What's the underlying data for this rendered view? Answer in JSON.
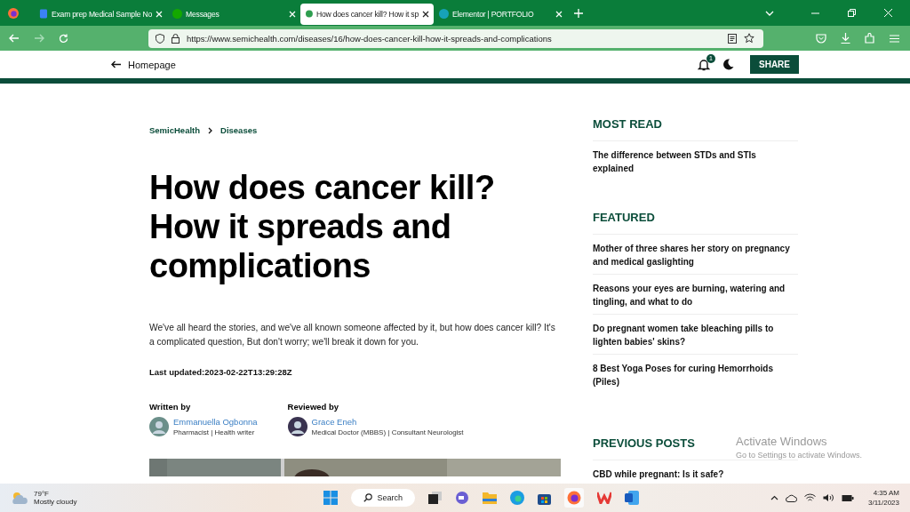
{
  "browser": {
    "tabs": [
      {
        "title": "Exam prep Medical Sample No",
        "selected": false
      },
      {
        "title": "Messages",
        "selected": false
      },
      {
        "title": "How does cancer kill? How it sp",
        "selected": true
      },
      {
        "title": "Elementor | PORTFOLIO",
        "selected": false
      }
    ],
    "url": "https://www.semichealth.com/diseases/16/how-does-cancer-kill-how-it-spreads-and-complications"
  },
  "header": {
    "back_label": "Homepage",
    "notification_count": "1",
    "share_label": "SHARE"
  },
  "breadcrumb": [
    "SemicHealth",
    "Diseases"
  ],
  "article": {
    "title": "How does cancer kill? How it spreads and complications",
    "intro": "We've all heard the stories, and we've all known someone affected by it, but how does cancer kill? It's a complicated question, But don't worry; we'll break it down for you.",
    "last_updated": "Last updated:2023-02-22T13:29:28Z",
    "authors": [
      {
        "role": "Written by",
        "name": "Emmanuella Ogbonna",
        "credentials": "Pharmacist | Health writer"
      },
      {
        "role": "Reviewed by",
        "name": "Grace Eneh",
        "credentials": "Medical Doctor (MBBS) | Consultant Neurologist"
      }
    ]
  },
  "sidebar": [
    {
      "heading": "MOST READ",
      "items": [
        "The difference between STDs and STIs explained"
      ]
    },
    {
      "heading": "FEATURED",
      "items": [
        "Mother of three shares her story on pregnancy and medical gaslighting",
        "Reasons your eyes are burning, watering and tingling, and what to do",
        "Do pregnant women take bleaching pills to lighten babies' skins?",
        "8 Best Yoga Poses for curing Hemorrhoids (Piles)"
      ]
    },
    {
      "heading": "PREVIOUS POSTS",
      "items": [
        "CBD while pregnant: Is it safe?"
      ]
    }
  ],
  "activation_notice": {
    "title": "Activate Windows",
    "text": "Go to Settings to activate Windows."
  },
  "taskbar": {
    "temperature": "79°F",
    "weather": "Mostly cloudy",
    "search_label": "Search",
    "time": "4:35 AM",
    "date": "3/11/2023"
  }
}
